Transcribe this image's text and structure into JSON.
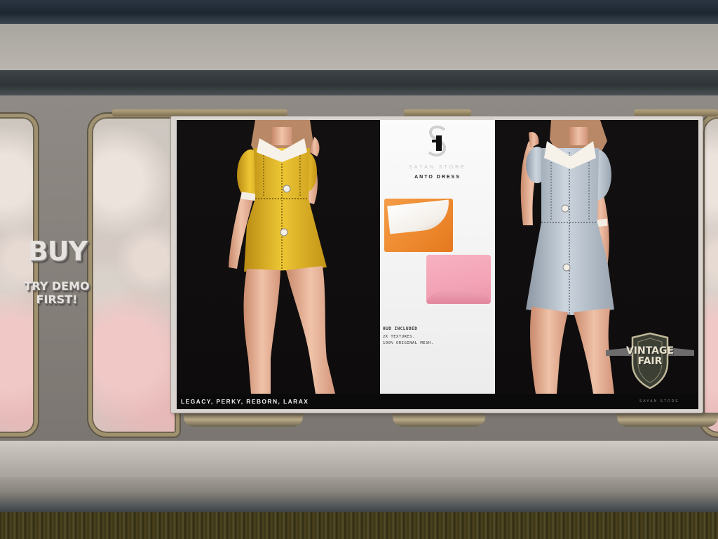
{
  "signage": {
    "buy": "BUY",
    "try_demo_line1": "TRY DEMO",
    "try_demo_line2": "FIRST!"
  },
  "poster": {
    "store_name": "SAYAN STORE",
    "product_name": "ANTO DRESS",
    "features_heading": "HUD INCLUDED",
    "features": [
      "2K TEXTURES.",
      "100% ORIGINAL MESH."
    ],
    "body_list": "LEGACY, PERKY, REBORN, LARAX",
    "footer_brand": "SAYAN STORE",
    "event_badge": {
      "line1": "VINTAGE",
      "line2": "FAIR"
    },
    "dress_colors": {
      "left_model": "#e9c02e",
      "right_model": "#c7d0da",
      "swatch_orange": "#ef8c33",
      "swatch_pink": "#f4a6b8"
    }
  },
  "icons": [
    "sayan-store-logo-icon",
    "vintage-fair-badge-icon"
  ]
}
